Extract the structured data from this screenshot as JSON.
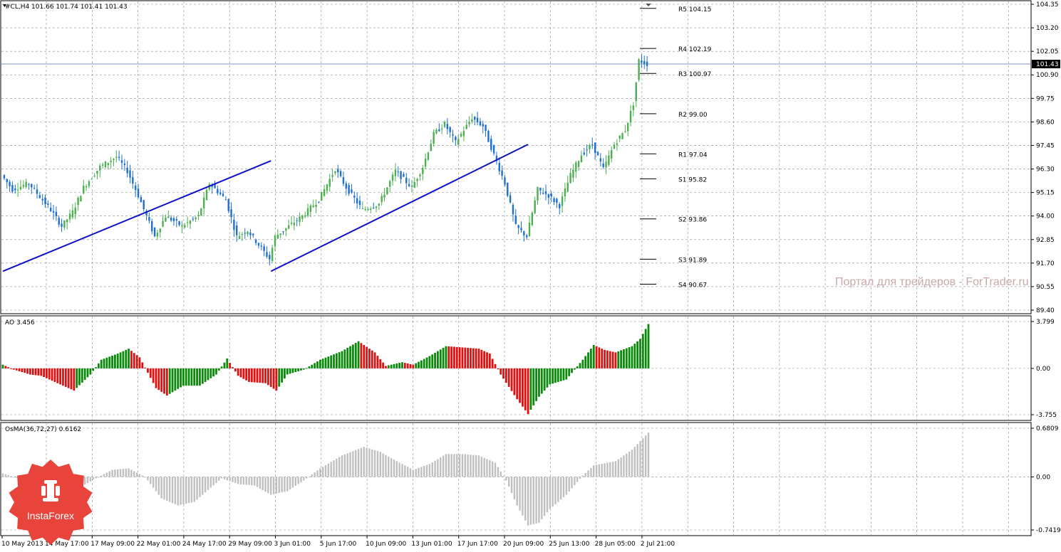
{
  "main_panel": {
    "header": "#CL,H4  101.66 101.74 101.41 101.43",
    "price_ticks": [
      "104.35",
      "103.20",
      "102.05",
      "100.90",
      "99.75",
      "98.60",
      "97.45",
      "96.30",
      "95.15",
      "94.00",
      "92.85",
      "91.70",
      "90.55",
      "89.40"
    ],
    "current_price": "101.43",
    "pivot_labels": [
      {
        "label": "R5 104.15",
        "value": 104.15
      },
      {
        "label": "R4 102.19",
        "value": 102.19
      },
      {
        "label": "R3 100.97",
        "value": 100.97
      },
      {
        "label": "R2 99.00",
        "value": 99.0
      },
      {
        "label": "R1 97.04",
        "value": 97.04
      },
      {
        "label": "S1 95.82",
        "value": 95.82
      },
      {
        "label": "S2 93.86",
        "value": 93.86
      },
      {
        "label": "S3 91.89",
        "value": 91.89
      },
      {
        "label": "S4 90.67",
        "value": 90.67
      }
    ],
    "watermark": "Портал для трейдеров - ForTrader.ru"
  },
  "ao_panel": {
    "header": "AO 3.456",
    "ticks": [
      "3.799",
      "0.00",
      "-3.755"
    ]
  },
  "osma_panel": {
    "header": "OsMA(36,72,27) 0.6162",
    "ticks": [
      "0.6809",
      "0.00",
      "-0.7419"
    ]
  },
  "time_axis": [
    "10 May 2013",
    "14 May 17:00",
    "17 May 09:00",
    "22 May 01:00",
    "24 May 17:00",
    "29 May 09:00",
    "3 Jun 01:00",
    "5 Jun 17:00",
    "10 Jun 09:00",
    "13 Jun 01:00",
    "17 Jun 17:00",
    "20 Jun 09:00",
    "25 Jun 13:00",
    "28 Jun 05:00",
    "2 Jul 21:00"
  ],
  "logo": {
    "text": "InstaForex"
  },
  "colors": {
    "bull": "#4caf50",
    "bear": "#1e6fd0",
    "trendline": "#1010c8",
    "ao_up": "#0a8a0a",
    "ao_down": "#e01010",
    "osma": "#c0c0c0",
    "grid": "#8c8c8c",
    "logo": "#e8443c"
  },
  "chart_data": [
    {
      "type": "candlestick",
      "title": "#CL,H4",
      "ylim": [
        89.4,
        104.35
      ],
      "anchors": [
        {
          "t": 0,
          "v": 96.0
        },
        {
          "t": 4,
          "v": 95.3
        },
        {
          "t": 10,
          "v": 95.6
        },
        {
          "t": 18,
          "v": 94.3
        },
        {
          "t": 22,
          "v": 93.5
        },
        {
          "t": 26,
          "v": 94.2
        },
        {
          "t": 30,
          "v": 95.4
        },
        {
          "t": 36,
          "v": 96.4
        },
        {
          "t": 42,
          "v": 96.9
        },
        {
          "t": 46,
          "v": 96.2
        },
        {
          "t": 50,
          "v": 95.0
        },
        {
          "t": 56,
          "v": 93.0
        },
        {
          "t": 60,
          "v": 94.0
        },
        {
          "t": 66,
          "v": 93.5
        },
        {
          "t": 72,
          "v": 94.0
        },
        {
          "t": 76,
          "v": 95.6
        },
        {
          "t": 82,
          "v": 94.8
        },
        {
          "t": 86,
          "v": 93.0
        },
        {
          "t": 90,
          "v": 93.3
        },
        {
          "t": 94,
          "v": 92.6
        },
        {
          "t": 98,
          "v": 91.9
        },
        {
          "t": 100,
          "v": 93.0
        },
        {
          "t": 104,
          "v": 93.4
        },
        {
          "t": 110,
          "v": 94.0
        },
        {
          "t": 116,
          "v": 94.8
        },
        {
          "t": 122,
          "v": 96.3
        },
        {
          "t": 126,
          "v": 95.4
        },
        {
          "t": 132,
          "v": 94.3
        },
        {
          "t": 138,
          "v": 94.6
        },
        {
          "t": 144,
          "v": 96.2
        },
        {
          "t": 150,
          "v": 95.4
        },
        {
          "t": 154,
          "v": 96.4
        },
        {
          "t": 158,
          "v": 98.0
        },
        {
          "t": 162,
          "v": 98.5
        },
        {
          "t": 166,
          "v": 97.6
        },
        {
          "t": 172,
          "v": 98.8
        },
        {
          "t": 176,
          "v": 98.4
        },
        {
          "t": 180,
          "v": 97.0
        },
        {
          "t": 184,
          "v": 95.6
        },
        {
          "t": 188,
          "v": 93.5
        },
        {
          "t": 192,
          "v": 93.0
        },
        {
          "t": 196,
          "v": 95.3
        },
        {
          "t": 200,
          "v": 95.0
        },
        {
          "t": 204,
          "v": 94.5
        },
        {
          "t": 208,
          "v": 96.0
        },
        {
          "t": 212,
          "v": 97.0
        },
        {
          "t": 216,
          "v": 97.5
        },
        {
          "t": 220,
          "v": 96.3
        },
        {
          "t": 224,
          "v": 97.5
        },
        {
          "t": 228,
          "v": 98.2
        },
        {
          "t": 231,
          "v": 99.5
        },
        {
          "t": 233,
          "v": 101.6
        },
        {
          "t": 236,
          "v": 101.43
        }
      ],
      "trendlines": [
        {
          "from": [
            0,
            91.3
          ],
          "to": [
            98,
            96.7
          ]
        },
        {
          "from": [
            98,
            91.3
          ],
          "to": [
            192,
            97.5
          ]
        }
      ],
      "horizontal_line": 101.43,
      "x_labels": [
        "10 May 2013",
        "14 May 17:00",
        "17 May 09:00",
        "22 May 01:00",
        "24 May 17:00",
        "29 May 09:00",
        "3 Jun 01:00",
        "5 Jun 17:00",
        "10 Jun 09:00",
        "13 Jun 01:00",
        "17 Jun 17:00",
        "20 Jun 09:00",
        "25 Jun 13:00",
        "28 Jun 05:00",
        "2 Jul 21:00"
      ]
    },
    {
      "type": "bar",
      "title": "AO 3.456",
      "ylim": [
        -3.755,
        3.799
      ],
      "anchors": [
        {
          "t": 0,
          "v": 0.3
        },
        {
          "t": 4,
          "v": -0.1
        },
        {
          "t": 10,
          "v": -0.5
        },
        {
          "t": 14,
          "v": -0.6
        },
        {
          "t": 20,
          "v": -1.2
        },
        {
          "t": 26,
          "v": -1.8
        },
        {
          "t": 32,
          "v": -0.5
        },
        {
          "t": 36,
          "v": 0.7
        },
        {
          "t": 42,
          "v": 1.2
        },
        {
          "t": 46,
          "v": 1.6
        },
        {
          "t": 50,
          "v": 0.9
        },
        {
          "t": 56,
          "v": -1.6
        },
        {
          "t": 60,
          "v": -2.2
        },
        {
          "t": 66,
          "v": -1.4
        },
        {
          "t": 72,
          "v": -1.4
        },
        {
          "t": 78,
          "v": -0.5
        },
        {
          "t": 82,
          "v": 0.8
        },
        {
          "t": 86,
          "v": -0.6
        },
        {
          "t": 90,
          "v": -1.1
        },
        {
          "t": 96,
          "v": -1.2
        },
        {
          "t": 100,
          "v": -1.8
        },
        {
          "t": 104,
          "v": -0.5
        },
        {
          "t": 110,
          "v": -0.1
        },
        {
          "t": 116,
          "v": 0.7
        },
        {
          "t": 124,
          "v": 1.4
        },
        {
          "t": 130,
          "v": 2.2
        },
        {
          "t": 136,
          "v": 1.3
        },
        {
          "t": 140,
          "v": 0.2
        },
        {
          "t": 146,
          "v": 0.5
        },
        {
          "t": 150,
          "v": 0.3
        },
        {
          "t": 156,
          "v": 1.0
        },
        {
          "t": 162,
          "v": 1.8
        },
        {
          "t": 168,
          "v": 1.7
        },
        {
          "t": 174,
          "v": 1.6
        },
        {
          "t": 178,
          "v": 1.2
        },
        {
          "t": 182,
          "v": -0.5
        },
        {
          "t": 188,
          "v": -2.5
        },
        {
          "t": 192,
          "v": -3.7
        },
        {
          "t": 196,
          "v": -2.3
        },
        {
          "t": 200,
          "v": -1.3
        },
        {
          "t": 206,
          "v": -0.9
        },
        {
          "t": 212,
          "v": 0.7
        },
        {
          "t": 216,
          "v": 1.9
        },
        {
          "t": 220,
          "v": 1.5
        },
        {
          "t": 224,
          "v": 1.3
        },
        {
          "t": 230,
          "v": 1.8
        },
        {
          "t": 233,
          "v": 2.4
        },
        {
          "t": 236,
          "v": 3.6
        }
      ]
    },
    {
      "type": "bar",
      "title": "OsMA(36,72,27) 0.6162",
      "ylim": [
        -0.7419,
        0.6809
      ],
      "anchors": [
        {
          "t": 0,
          "v": 0.05
        },
        {
          "t": 8,
          "v": -0.05
        },
        {
          "t": 14,
          "v": -0.12
        },
        {
          "t": 20,
          "v": -0.2
        },
        {
          "t": 28,
          "v": -0.15
        },
        {
          "t": 34,
          "v": -0.02
        },
        {
          "t": 40,
          "v": 0.1
        },
        {
          "t": 46,
          "v": 0.12
        },
        {
          "t": 52,
          "v": 0.0
        },
        {
          "t": 58,
          "v": -0.3
        },
        {
          "t": 64,
          "v": -0.4
        },
        {
          "t": 70,
          "v": -0.35
        },
        {
          "t": 76,
          "v": -0.15
        },
        {
          "t": 80,
          "v": -0.02
        },
        {
          "t": 86,
          "v": -0.1
        },
        {
          "t": 92,
          "v": -0.12
        },
        {
          "t": 98,
          "v": -0.25
        },
        {
          "t": 104,
          "v": -0.2
        },
        {
          "t": 110,
          "v": -0.05
        },
        {
          "t": 116,
          "v": 0.12
        },
        {
          "t": 124,
          "v": 0.3
        },
        {
          "t": 132,
          "v": 0.42
        },
        {
          "t": 138,
          "v": 0.35
        },
        {
          "t": 144,
          "v": 0.22
        },
        {
          "t": 150,
          "v": 0.1
        },
        {
          "t": 156,
          "v": 0.18
        },
        {
          "t": 162,
          "v": 0.32
        },
        {
          "t": 168,
          "v": 0.32
        },
        {
          "t": 174,
          "v": 0.3
        },
        {
          "t": 180,
          "v": 0.2
        },
        {
          "t": 184,
          "v": -0.05
        },
        {
          "t": 188,
          "v": -0.4
        },
        {
          "t": 192,
          "v": -0.68
        },
        {
          "t": 196,
          "v": -0.64
        },
        {
          "t": 200,
          "v": -0.45
        },
        {
          "t": 206,
          "v": -0.25
        },
        {
          "t": 212,
          "v": 0.02
        },
        {
          "t": 216,
          "v": 0.16
        },
        {
          "t": 224,
          "v": 0.22
        },
        {
          "t": 230,
          "v": 0.38
        },
        {
          "t": 236,
          "v": 0.62
        }
      ]
    }
  ]
}
